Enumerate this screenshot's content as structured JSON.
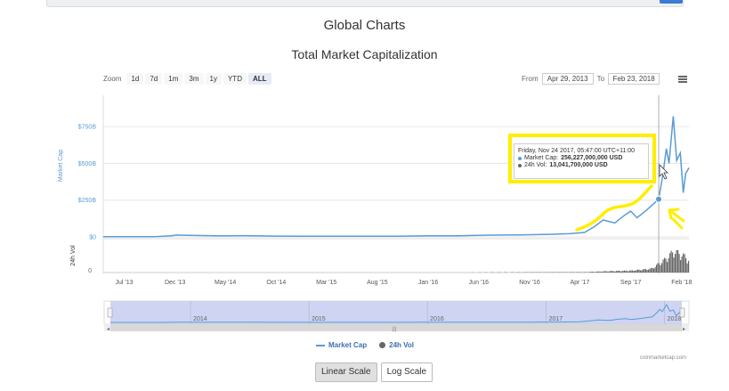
{
  "page_title": "Global Charts",
  "toolbar": {
    "zoom_label": "Zoom",
    "zoom_options": [
      "1d",
      "7d",
      "1m",
      "3m",
      "1y",
      "YTD",
      "ALL"
    ],
    "zoom_active": "ALL",
    "from_label": "From",
    "from_value": "Apr 29, 2013",
    "to_label": "To",
    "to_value": "Feb 23, 2018"
  },
  "tooltip": {
    "date": "Friday, Nov 24 2017, 05:47:00 UTC+11:00",
    "mcap_label": "Market Cap:",
    "mcap_value": "256,227,000,000 USD",
    "vol_label": "24h Vol:",
    "vol_value": "13,041,700,000 USD"
  },
  "legend": {
    "market_cap": "Market Cap",
    "vol": "24h Vol"
  },
  "credit": "coinmarketcap.com",
  "scale_buttons": {
    "linear": "Linear Scale",
    "log": "Log Scale",
    "active": "linear"
  },
  "colors": {
    "market_cap": "#5a9bd5",
    "volume": "#666666",
    "navigator": "#c5cdee",
    "highlight": "#ffee00"
  },
  "chart_data": {
    "type": "line",
    "title": "Total Market Capitalization",
    "ylabel": "Market Cap",
    "ylabel2": "24h Vol",
    "yticks": [
      "$0",
      "$250B",
      "$500B",
      "$750B"
    ],
    "ylim": [
      0,
      900
    ],
    "ytick_values": [
      0,
      250,
      500,
      750
    ],
    "vol_ytick": "0",
    "xticks": [
      "Jul '13",
      "Dec '13",
      "May '14",
      "Oct '14",
      "Mar '15",
      "Aug '15",
      "Jan '16",
      "Jun '16",
      "Nov '16",
      "Apr '17",
      "Sep '17",
      "Feb '18"
    ],
    "navigator_ticks": [
      "2014",
      "2015",
      "2016",
      "2017",
      "2018"
    ],
    "series": [
      {
        "name": "Market Cap",
        "x": [
          "2013-04-29",
          "2013-07-01",
          "2013-10-01",
          "2013-11-20",
          "2013-12-05",
          "2014-01-15",
          "2014-04-01",
          "2014-07-01",
          "2014-10-01",
          "2015-01-01",
          "2015-04-01",
          "2015-07-01",
          "2015-10-01",
          "2016-01-01",
          "2016-04-01",
          "2016-07-01",
          "2016-10-01",
          "2017-01-01",
          "2017-03-01",
          "2017-04-15",
          "2017-05-15",
          "2017-06-10",
          "2017-07-15",
          "2017-08-15",
          "2017-09-01",
          "2017-09-20",
          "2017-10-15",
          "2017-11-01",
          "2017-11-24",
          "2017-12-07",
          "2017-12-17",
          "2017-12-25",
          "2018-01-07",
          "2018-01-17",
          "2018-01-28",
          "2018-02-06",
          "2018-02-13",
          "2018-02-23"
        ],
        "values": [
          1.6,
          1.2,
          2.0,
          8.0,
          13.0,
          10.0,
          7.5,
          8.5,
          5.5,
          5.0,
          4.0,
          5.0,
          4.0,
          7.0,
          7.5,
          12.0,
          14.0,
          17.5,
          22.0,
          30.0,
          70.0,
          115.0,
          95.0,
          150.0,
          175.0,
          130.0,
          175.0,
          210.0,
          256.2,
          430.0,
          600.0,
          500.0,
          820.0,
          520.0,
          570.0,
          300.0,
          430.0,
          470.0
        ]
      },
      {
        "name": "24h Vol",
        "x": [
          "2013-04-29",
          "2016-01-01",
          "2017-04-15",
          "2017-07-01",
          "2017-09-01",
          "2017-11-01",
          "2017-12-17",
          "2018-01-07",
          "2018-02-06",
          "2018-02-23"
        ],
        "values": [
          0.1,
          0.3,
          1,
          3,
          4,
          8,
          30,
          45,
          35,
          25
        ]
      }
    ]
  }
}
